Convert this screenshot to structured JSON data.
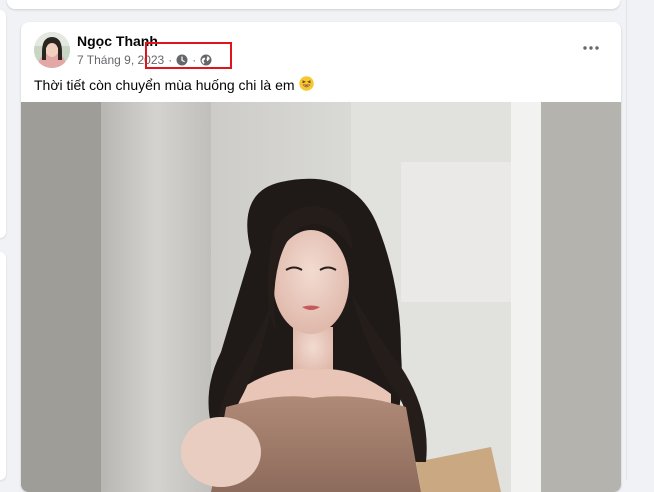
{
  "post": {
    "author": "Ngọc Thanh",
    "date": "7 Tháng 9, 2023",
    "separator": "·",
    "privacy_icon": "globe-icon",
    "time_icon": "clock-icon",
    "caption": "Thời tiết còn chuyển mùa huống chi là em",
    "caption_emoji": "grinning-squinting-face",
    "more_icon": "more-options-icon"
  },
  "colors": {
    "background": "#f0f2f5",
    "card": "#ffffff",
    "text_primary": "#050505",
    "text_secondary": "#65676b",
    "highlight_box": "#e0141c"
  }
}
